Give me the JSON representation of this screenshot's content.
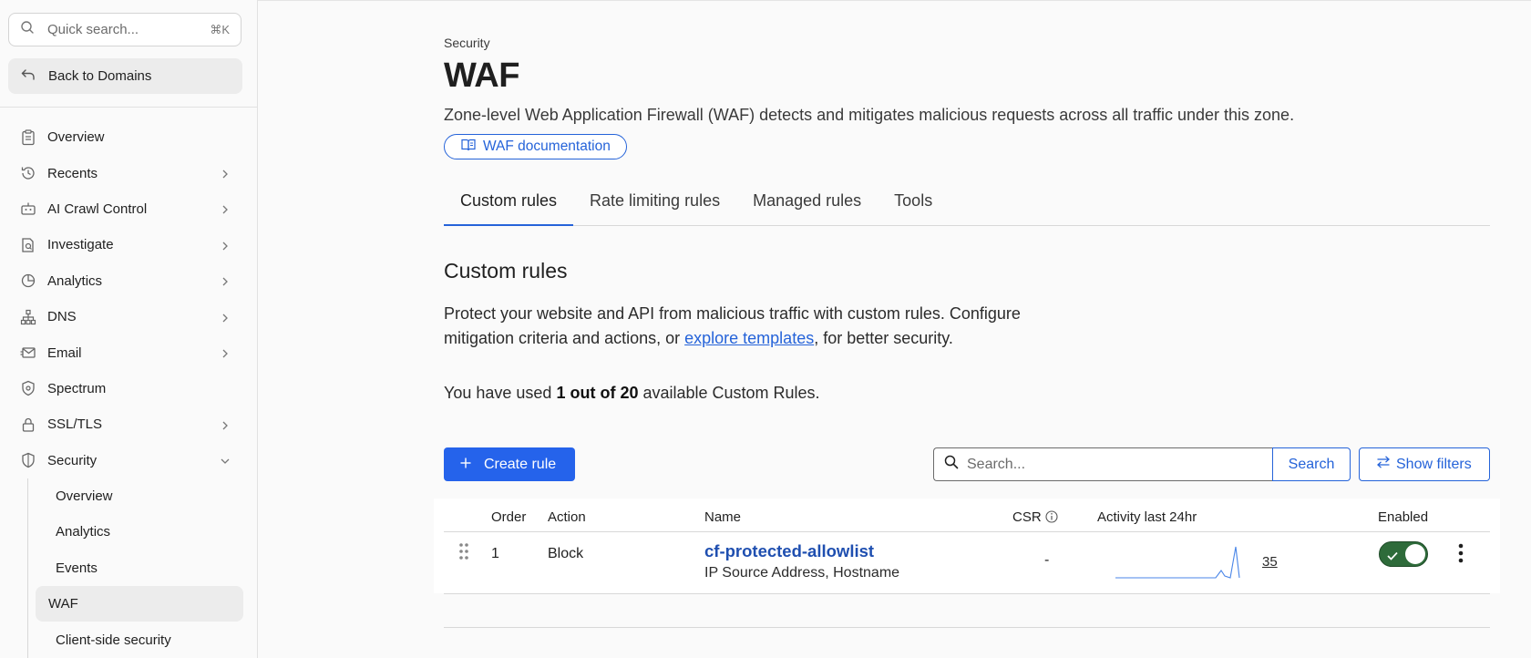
{
  "sidebar": {
    "quick_search": {
      "placeholder": "Quick search...",
      "shortcut": "⌘K"
    },
    "back_label": "Back to Domains",
    "items": [
      {
        "label": "Overview",
        "icon": "clipboard-icon",
        "chevron": false
      },
      {
        "label": "Recents",
        "icon": "history-icon",
        "chevron": true
      },
      {
        "label": "AI Crawl Control",
        "icon": "robot-icon",
        "chevron": true
      },
      {
        "label": "Investigate",
        "icon": "document-search-icon",
        "chevron": true
      },
      {
        "label": "Analytics",
        "icon": "pie-chart-icon",
        "chevron": true
      },
      {
        "label": "DNS",
        "icon": "network-icon",
        "chevron": true
      },
      {
        "label": "Email",
        "icon": "envelope-icon",
        "chevron": true
      },
      {
        "label": "Spectrum",
        "icon": "shield-gear-icon",
        "chevron": false
      },
      {
        "label": "SSL/TLS",
        "icon": "lock-icon",
        "chevron": true
      },
      {
        "label": "Security",
        "icon": "shield-icon",
        "chevron": "open"
      }
    ],
    "security_sub": [
      {
        "label": "Overview"
      },
      {
        "label": "Analytics"
      },
      {
        "label": "Events"
      },
      {
        "label": "WAF",
        "active": true
      },
      {
        "label": "Client-side security"
      }
    ]
  },
  "main": {
    "eyebrow": "Security",
    "title": "WAF",
    "description": "Zone-level Web Application Firewall (WAF) detects and mitigates malicious requests across all traffic under this zone.",
    "doc_link": "WAF documentation",
    "tabs": [
      {
        "label": "Custom rules",
        "active": true
      },
      {
        "label": "Rate limiting rules"
      },
      {
        "label": "Managed rules"
      },
      {
        "label": "Tools"
      }
    ],
    "section_title": "Custom rules",
    "para_before": "Protect your website and API from malicious traffic with custom rules. Configure mitigation criteria and actions, or ",
    "para_link": "explore templates",
    "para_after": ", for better security.",
    "usage_before": "You have used ",
    "usage_bold": "1 out of 20",
    "usage_after": " available Custom Rules.",
    "create_label": "Create rule",
    "search_placeholder": "Search...",
    "search_button": "Search",
    "filters_button": "Show filters"
  },
  "table": {
    "columns": [
      "Order",
      "Action",
      "Name",
      "CSR",
      "Activity last 24hr",
      "Enabled"
    ],
    "rows": [
      {
        "order": "1",
        "action": "Block",
        "name": "cf-protected-allowlist",
        "fields": "IP Source Address, Hostname",
        "csr": "-",
        "activity_count": "35",
        "enabled": true
      }
    ]
  },
  "colors": {
    "accent": "#2563eb",
    "toggle_on": "#2e6b3a"
  }
}
